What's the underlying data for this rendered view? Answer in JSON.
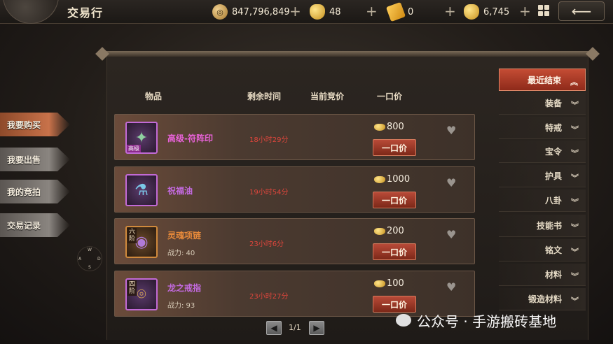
{
  "header": {
    "title": "交易行",
    "currencies": [
      {
        "name": "gold-coin",
        "icon": "coin-icon",
        "value": "847,796,849"
      },
      {
        "name": "ingot",
        "icon": "ingot-icon",
        "value": "48"
      },
      {
        "name": "ticket",
        "icon": "ticket-icon",
        "value": "0"
      },
      {
        "name": "bound-ingot",
        "icon": "ingot-icon",
        "value": "6,745"
      }
    ],
    "plus_label": "+",
    "back_label": "⟵"
  },
  "sidebar": {
    "tabs": [
      {
        "label": "我要购买",
        "active": true
      },
      {
        "label": "我要出售",
        "active": false
      },
      {
        "label": "我的竞拍",
        "active": false
      },
      {
        "label": "交易记录",
        "active": false
      }
    ]
  },
  "compass": {
    "n": "W",
    "w": "A",
    "e": "D",
    "s": "S"
  },
  "table": {
    "columns": [
      "物品",
      "剩余时间",
      "当前竞价",
      "一口价"
    ],
    "rows": [
      {
        "name": "高级-符阵印",
        "name_color": "#e862d8",
        "grade": "高级",
        "tier": "",
        "power": "",
        "time": "18小时29分",
        "price": "800",
        "buyout": "一口价",
        "icon": "talisman-icon"
      },
      {
        "name": "祝福油",
        "name_color": "#c36ae0",
        "grade": "",
        "tier": "",
        "power": "",
        "time": "19小时54分",
        "price": "1000",
        "buyout": "一口价",
        "icon": "potion-icon"
      },
      {
        "name": "灵魂项链",
        "name_color": "#e88a3a",
        "grade": "",
        "tier": "六阶",
        "power": "战力: 40",
        "time": "23小时6分",
        "price": "200",
        "buyout": "一口价",
        "icon": "necklace-icon"
      },
      {
        "name": "龙之戒指",
        "name_color": "#c36ae0",
        "grade": "",
        "tier": "四阶",
        "power": "战力: 93",
        "time": "23小时27分",
        "price": "100",
        "buyout": "一口价",
        "icon": "ring-icon"
      }
    ]
  },
  "filters": {
    "items": [
      "最近结束",
      "装备",
      "特戒",
      "宝令",
      "护具",
      "八卦",
      "技能书",
      "铭文",
      "材料",
      "锻造材料"
    ]
  },
  "pagination": {
    "text": "1/1"
  },
  "watermark": {
    "text": "公众号 · 手游搬砖基地"
  }
}
